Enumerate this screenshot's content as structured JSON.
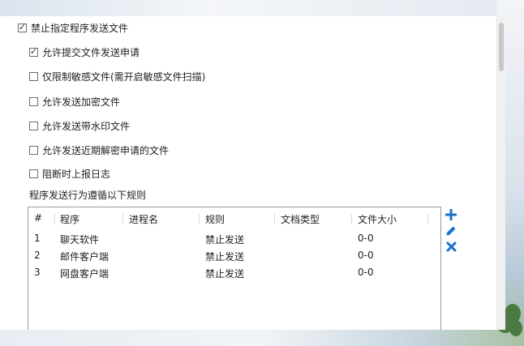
{
  "options": {
    "master": {
      "label": "禁止指定程序发送文件",
      "checked": true
    },
    "items": [
      {
        "label": "允许提交文件发送申请",
        "checked": true
      },
      {
        "label": "仅限制敏感文件(需开启敏感文件扫描)",
        "checked": false
      },
      {
        "label": "允许发送加密文件",
        "checked": false
      },
      {
        "label": "允许发送带水印文件",
        "checked": false
      },
      {
        "label": "允许发送近期解密申请的文件",
        "checked": false
      },
      {
        "label": "阻断时上报日志",
        "checked": false
      }
    ]
  },
  "rules": {
    "title": "程序发送行为遵循以下规则",
    "columns": [
      "#",
      "程序",
      "进程名",
      "规则",
      "文档类型",
      "文件大小"
    ],
    "rows": [
      [
        "1",
        "聊天软件",
        "",
        "禁止发送",
        "",
        "0-0"
      ],
      [
        "2",
        "邮件客户端",
        "",
        "禁止发送",
        "",
        "0-0"
      ],
      [
        "3",
        "网盘客户端",
        "",
        "禁止发送",
        "",
        "0-0"
      ]
    ]
  },
  "actions": {
    "add_icon": "plus-icon",
    "edit_icon": "pencil-icon",
    "delete_icon": "x-icon",
    "accent": "#1a73c9"
  }
}
